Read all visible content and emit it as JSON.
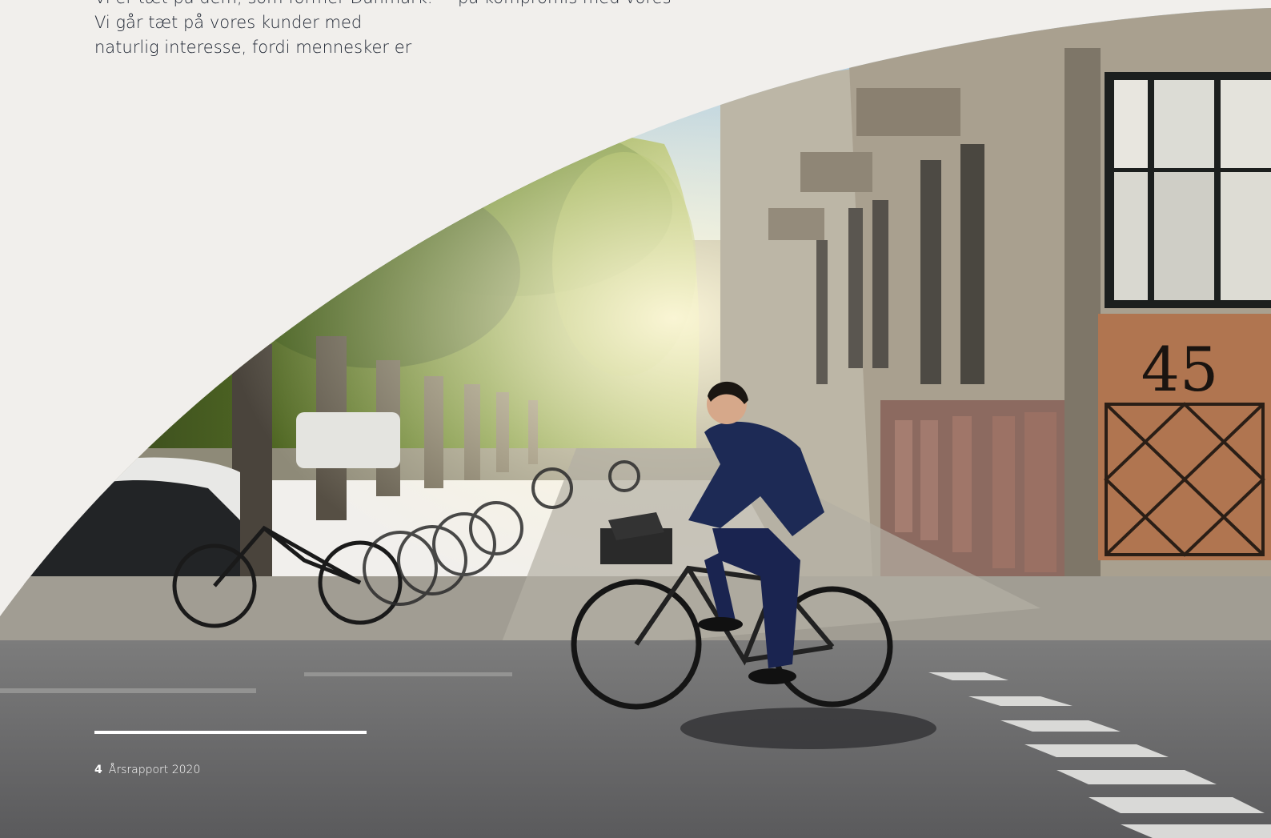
{
  "intro": {
    "col1_lines": [
      "Vi er tæt på dem, som former Danmark.",
      "Vi går tæt på vores kunder med",
      "naturlig interesse, fordi mennesker er"
    ],
    "col2_lines": [
      "på kompromis med vores"
    ]
  },
  "photo": {
    "building_number": "45"
  },
  "footer": {
    "page_number": "4",
    "report_title": "Årsrapport 2020"
  },
  "colors": {
    "page_background": "#f1efec",
    "text": "#1f2633",
    "footer_text": "#ffffff"
  }
}
